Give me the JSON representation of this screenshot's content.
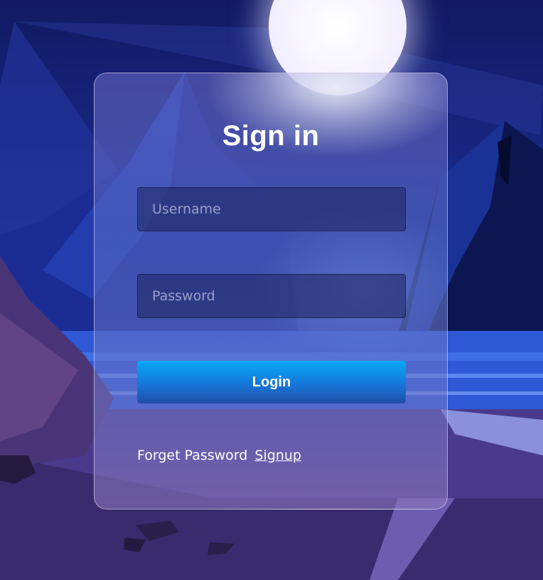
{
  "login_form": {
    "title": "Sign in",
    "username_placeholder": "Username",
    "password_placeholder": "Password",
    "login_label": "Login",
    "forget_password_label": "Forget Password",
    "signup_label": "Signup"
  },
  "colors": {
    "button_top": "#08a9f7",
    "button_bottom": "#214ea8",
    "sky": "#111a63",
    "text": "#ffffff"
  }
}
